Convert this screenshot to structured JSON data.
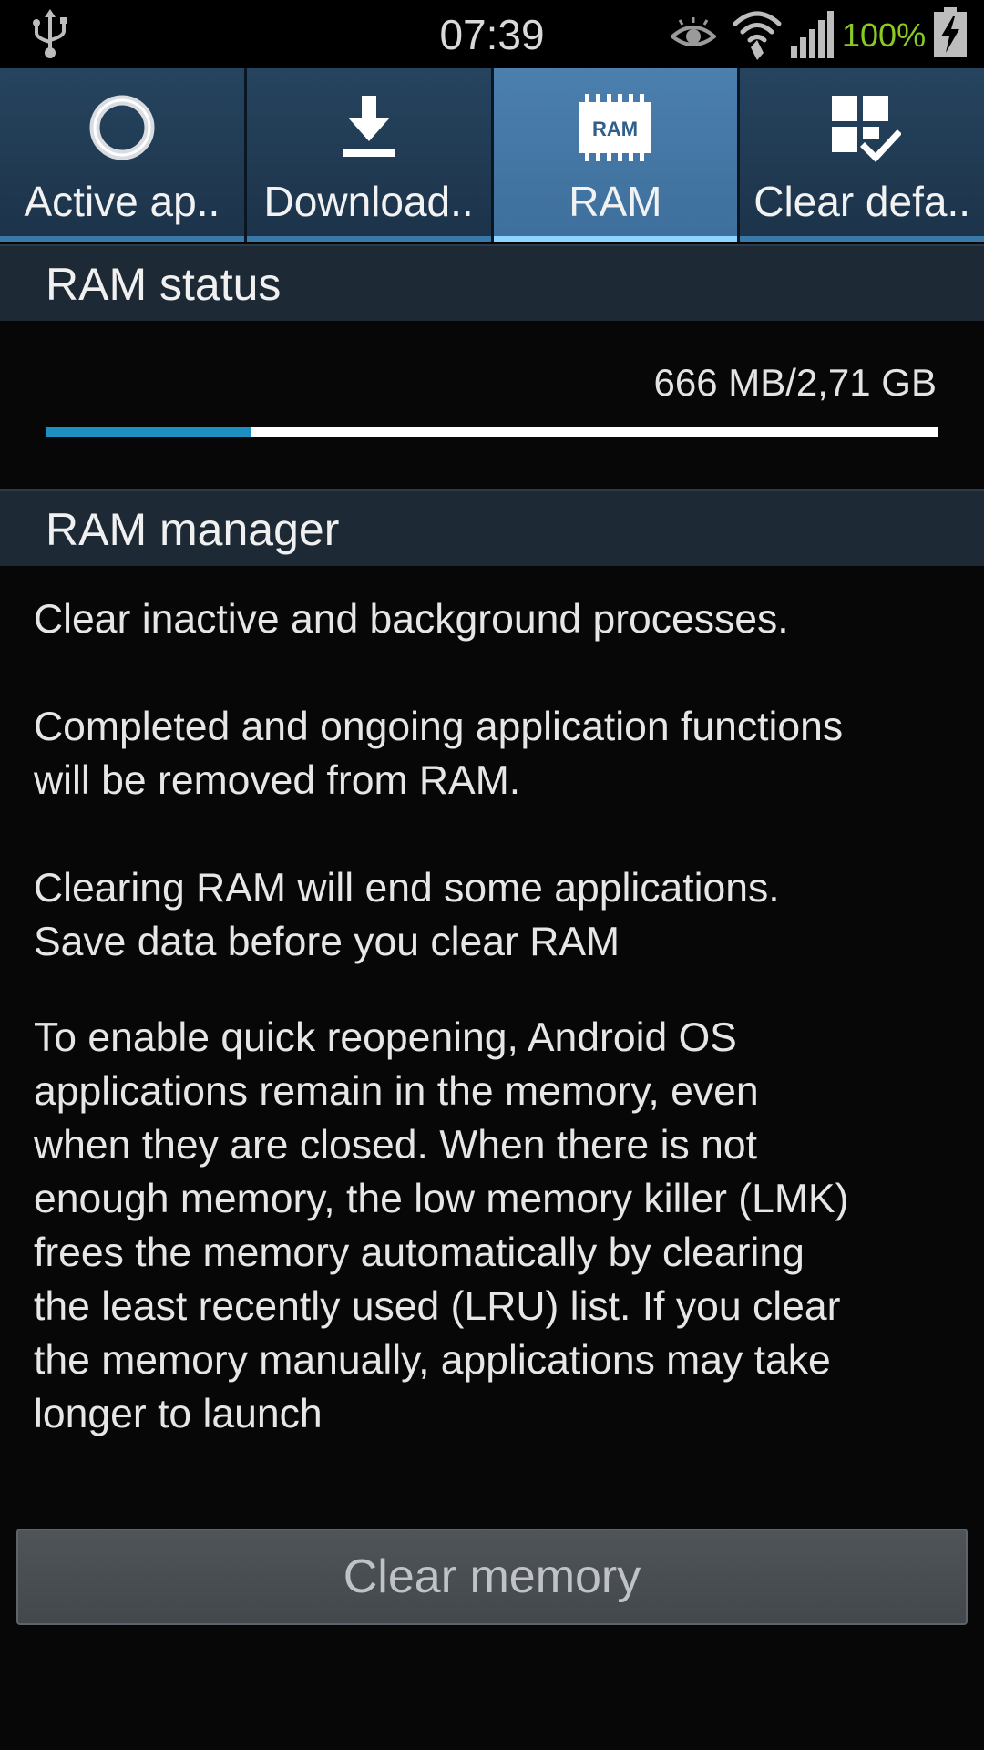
{
  "status_bar": {
    "time": "07:39",
    "battery_percent_text": "100%",
    "icons": [
      "usb-icon",
      "smart-stay-eye-icon",
      "wifi-icon",
      "signal-icon",
      "battery-charging-icon"
    ],
    "battery_text_color": "#8ac926"
  },
  "tabs": [
    {
      "label": "Active ap..",
      "icon": "active-apps-ring-icon",
      "active": false
    },
    {
      "label": "Download..",
      "icon": "download-icon",
      "active": false
    },
    {
      "label": "RAM",
      "icon": "ram-chip-icon",
      "icon_text": "RAM",
      "active": true
    },
    {
      "label": "Clear defa..",
      "icon": "clear-defaults-icon",
      "active": false
    }
  ],
  "ram_status": {
    "header": "RAM status",
    "usage_text": "666 MB/2,71 GB",
    "usage_fraction": 0.23,
    "bar_fill_color": "#1d8fc0"
  },
  "ram_manager": {
    "header": "RAM manager",
    "paragraphs": [
      "Clear inactive and background processes.",
      "Completed and ongoing application functions\nwill be removed from RAM.",
      "Clearing RAM will end some applications.\nSave data before you clear RAM",
      "To enable quick reopening, Android OS\napplications remain in the memory, even\nwhen they are closed. When there is not\nenough memory, the low memory killer (LMK)\nfrees the memory automatically by clearing\nthe least recently used (LRU) list. If you clear\nthe memory manually, applications may take\nlonger to launch"
    ]
  },
  "clear_button": {
    "label": "Clear memory"
  }
}
